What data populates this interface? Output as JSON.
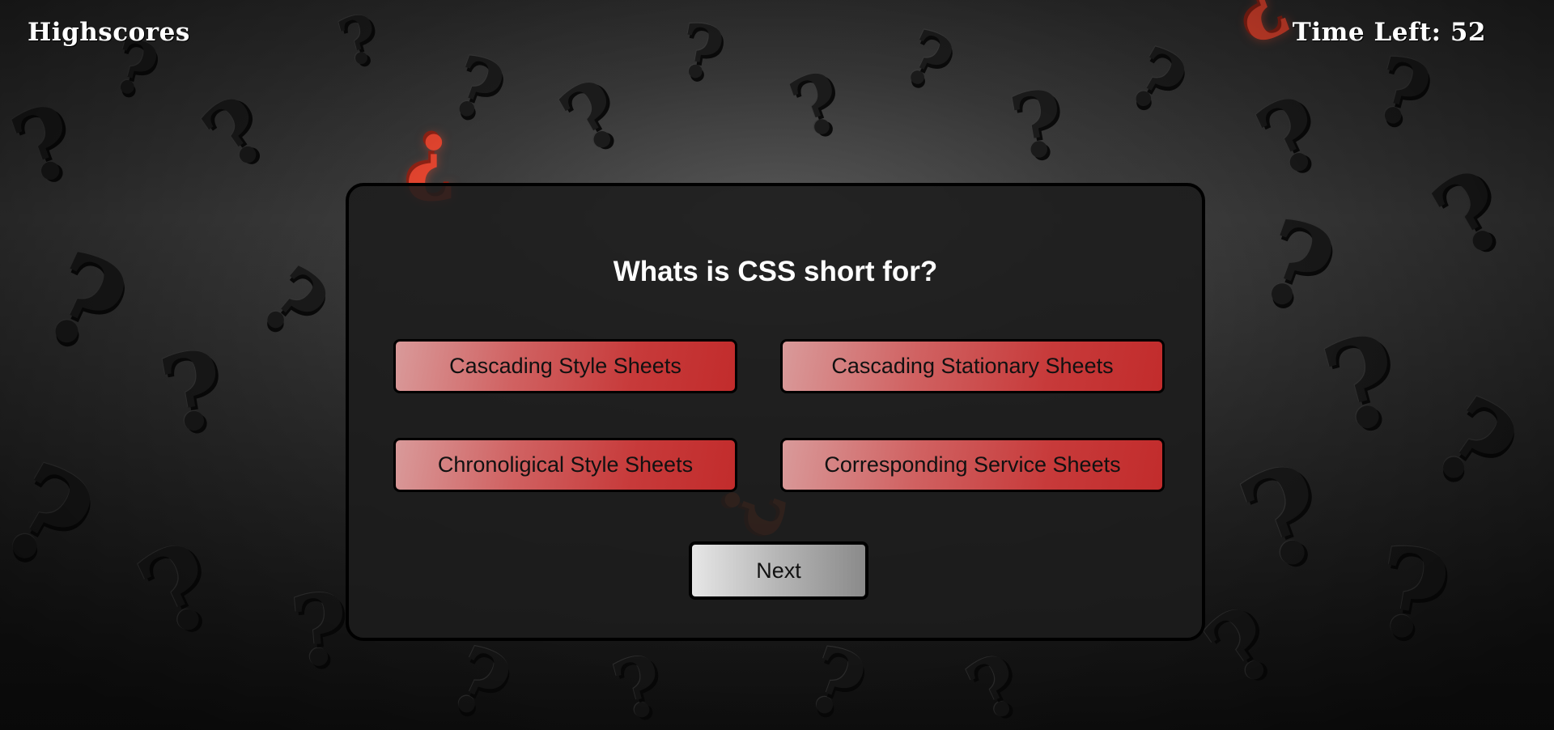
{
  "header": {
    "highscores_label": "Highscores",
    "timer_label": "Time Left: 52"
  },
  "quiz": {
    "question": "Whats is CSS short for?",
    "answers": [
      "Cascading Style Sheets",
      "Cascading Stationary Sheets",
      "Chronoligical Style Sheets",
      "Corresponding Service Sheets"
    ],
    "next_label": "Next"
  },
  "colors": {
    "answer_red": "#c73a3a",
    "accent_question_mark": "#e5452f",
    "background": "#2b2b2b"
  }
}
